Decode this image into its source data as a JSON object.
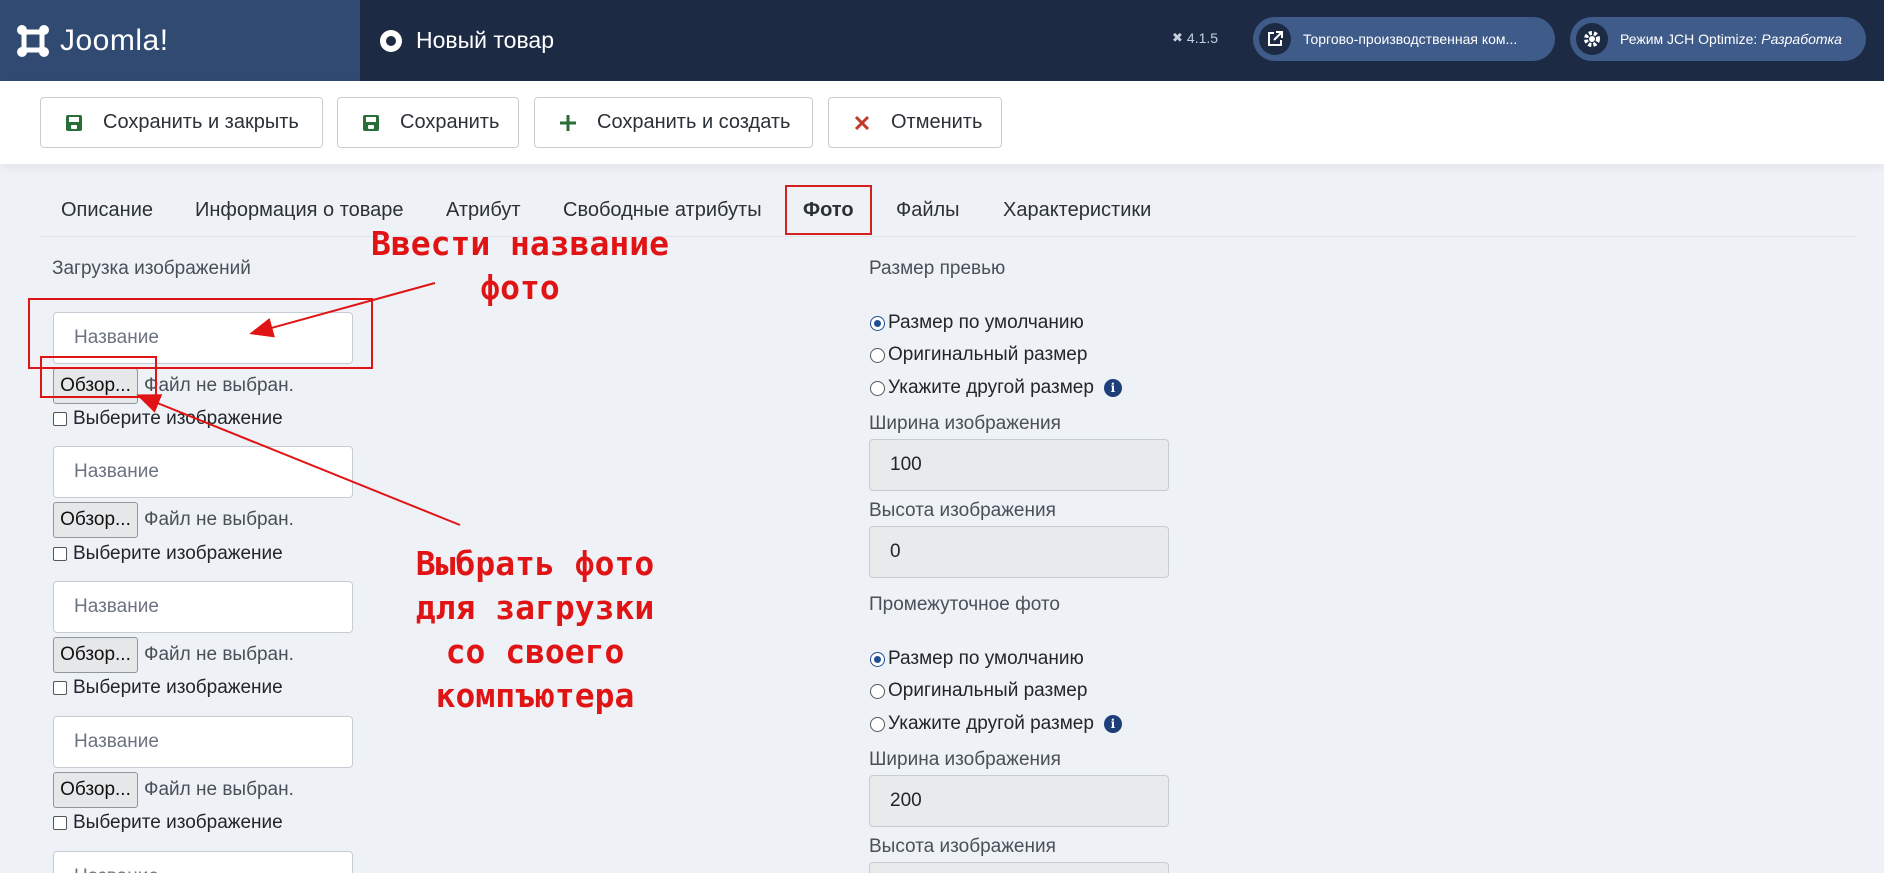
{
  "header": {
    "logo_text": "Joomla!",
    "page_title": "Новый товар",
    "version": "4.1.5",
    "site_link": "Торгово-производственная ком...",
    "jch_mode_prefix": "Режим JCH Optimize:",
    "jch_mode_value": "Разработка"
  },
  "toolbar": {
    "save_close": "Сохранить и закрыть",
    "save": "Сохранить",
    "save_new": "Сохранить и создать",
    "cancel": "Отменить"
  },
  "tabs": [
    "Описание",
    "Информация о товаре",
    "Атрибут",
    "Свободные атрибуты",
    "Фото",
    "Файлы",
    "Характеристики"
  ],
  "active_tab": "Фото",
  "upload": {
    "section_title": "Загрузка изображений",
    "name_placeholder": "Название",
    "browse_label": "Обзор...",
    "no_file": "Файл не выбран.",
    "select_label": "Выберите изображение"
  },
  "preview": {
    "section_title": "Размер превью",
    "options": [
      "Размер по умолчанию",
      "Оригинальный размер",
      "Укажите другой размер"
    ],
    "selected": "Размер по умолчанию",
    "width_label": "Ширина изображения",
    "width_value": "100",
    "height_label": "Высота изображения",
    "height_value": "0"
  },
  "intermediate": {
    "section_title": "Промежуточное фото",
    "options": [
      "Размер по умолчанию",
      "Оригинальный размер",
      "Укажите другой размер"
    ],
    "selected": "Размер по умолчанию",
    "width_label": "Ширина изображения",
    "width_value": "200",
    "height_label": "Высота изображения"
  },
  "annotations": {
    "enter_name": "Ввести название фото",
    "choose_photo_line1": "Выбрать фото",
    "choose_photo_line2": "для загрузки",
    "choose_photo_line3": "со своего компъютера"
  },
  "colors": {
    "header_bg": "#1c2a44",
    "logo_bg": "#304a72",
    "annotation": "#e01414",
    "save_icon": "#2a6e37",
    "cancel_icon": "#c0392b"
  }
}
